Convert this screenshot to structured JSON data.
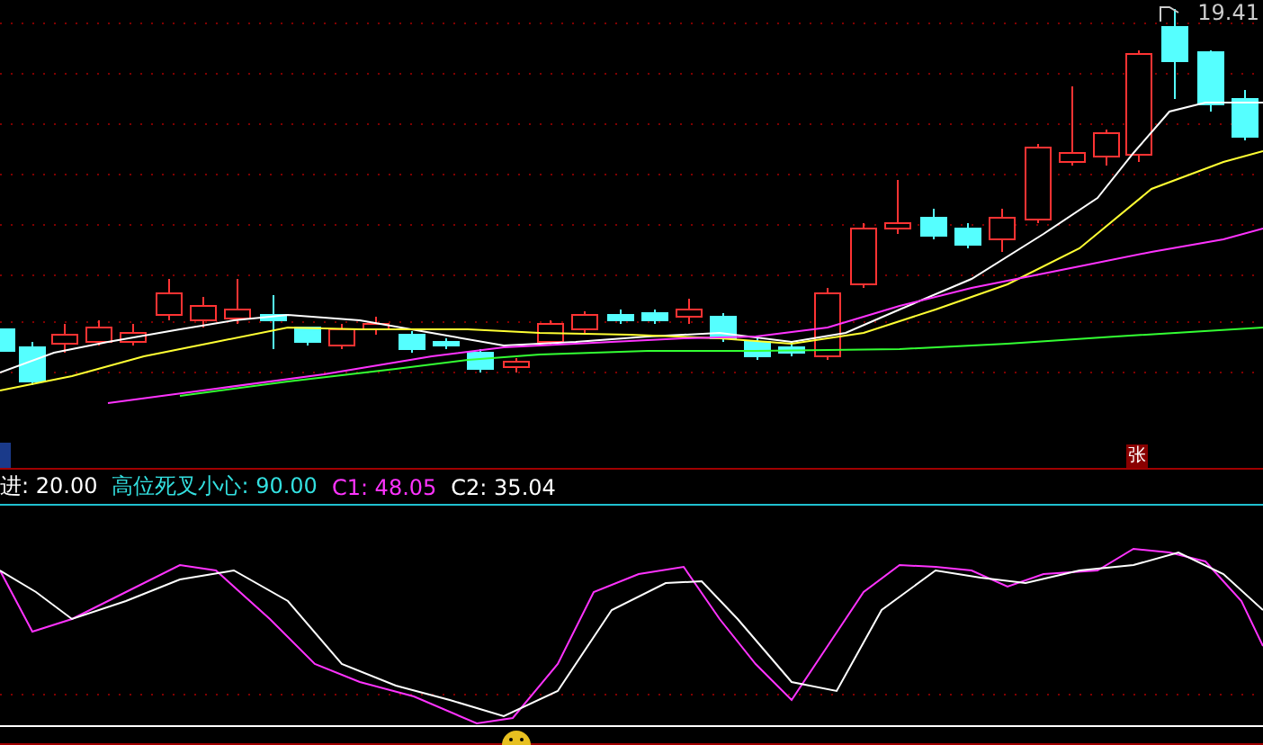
{
  "chart": {
    "price_label": "19.41",
    "badge": "张"
  },
  "legend": [
    {
      "label": "进: 20.00",
      "color": "#ffffff"
    },
    {
      "label": "高位死叉小心: 90.00",
      "color": "#33e0e0"
    },
    {
      "label": "C1: 48.05",
      "color": "#ff33ff"
    },
    {
      "label": "C2: 35.04",
      "color": "#ffffff"
    }
  ]
}
